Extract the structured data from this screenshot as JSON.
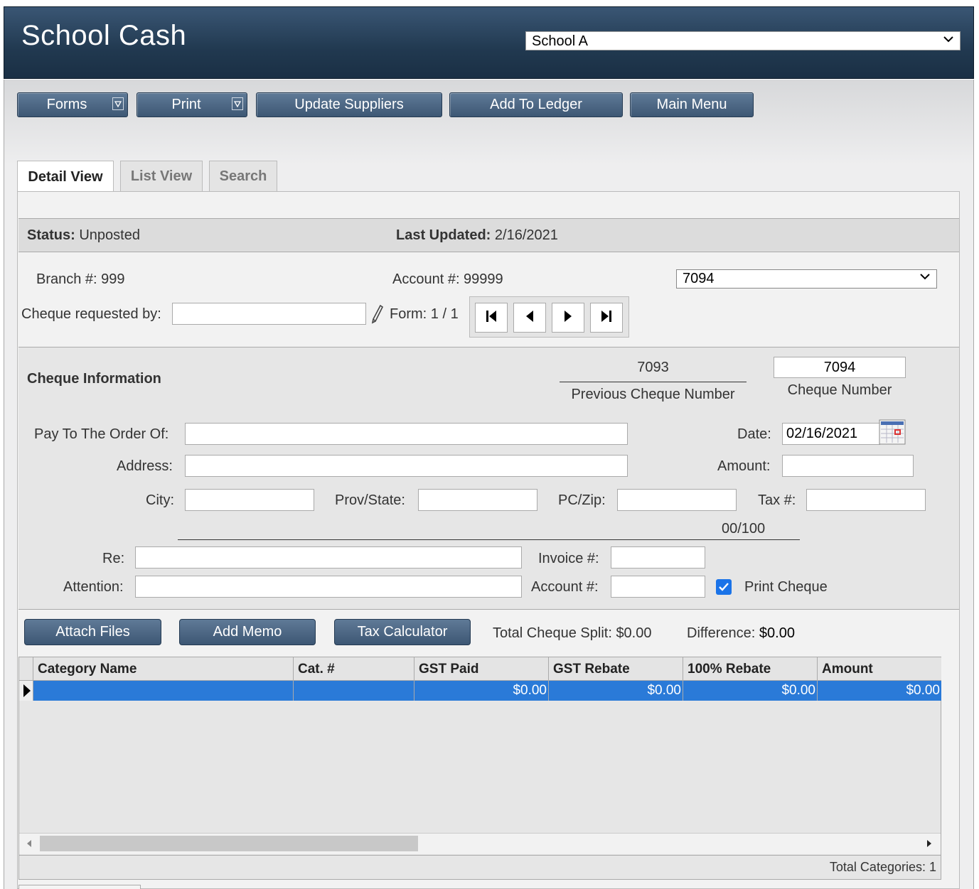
{
  "header": {
    "title": "School Cash",
    "school_selected": "School A"
  },
  "toolbar": {
    "forms": "Forms",
    "print": "Print",
    "update_suppliers": "Update Suppliers",
    "add_to_ledger": "Add To Ledger",
    "main_menu": "Main Menu"
  },
  "tabs": {
    "detail": "Detail View",
    "list": "List View",
    "search": "Search"
  },
  "status": {
    "status_label": "Status:",
    "status_value": "Unposted",
    "updated_label": "Last Updated:",
    "updated_value": "2/16/2021"
  },
  "info": {
    "branch": "Branch #: 999",
    "account": "Account #: 99999",
    "cheque_select": "7094",
    "requested_by_label": "Cheque requested by:",
    "requested_by_value": "",
    "form_label": "Form: 1 / 1"
  },
  "cheque": {
    "section_title": "Cheque Information",
    "previous_number": "7093",
    "previous_label": "Previous Cheque Number",
    "number": "7094",
    "number_label": "Cheque Number",
    "pay_to_label": "Pay To The Order Of:",
    "address_label": "Address:",
    "city_label": "City:",
    "prov_label": "Prov/State:",
    "pczip_label": "PC/Zip:",
    "tax_label": "Tax #:",
    "date_label": "Date:",
    "date_value": "02/16/2021",
    "amount_label": "Amount:",
    "fraction_text": "00/100",
    "re_label": "Re:",
    "attention_label": "Attention:",
    "invoice_label": "Invoice #:",
    "account_label": "Account #:",
    "print_cheque_label": "Print Cheque",
    "print_cheque_checked": true
  },
  "actions": {
    "attach_files": "Attach Files",
    "add_memo": "Add Memo",
    "tax_calculator": "Tax Calculator",
    "total_split": "Total Cheque Split: $0.00",
    "difference_label": "Difference:",
    "difference_value": "$0.00"
  },
  "grid": {
    "columns": [
      "Category Name",
      "Cat. #",
      "GST Paid",
      "GST Rebate",
      "100% Rebate",
      "Amount"
    ],
    "rows": [
      [
        "",
        "",
        "$0.00",
        "$0.00",
        "$0.00",
        "$0.00"
      ]
    ],
    "footer": "Total Categories: 1"
  },
  "colors": {
    "header_bg": "#213950",
    "button_bg": "#4a6583",
    "selected_row": "#2a7ad8"
  }
}
